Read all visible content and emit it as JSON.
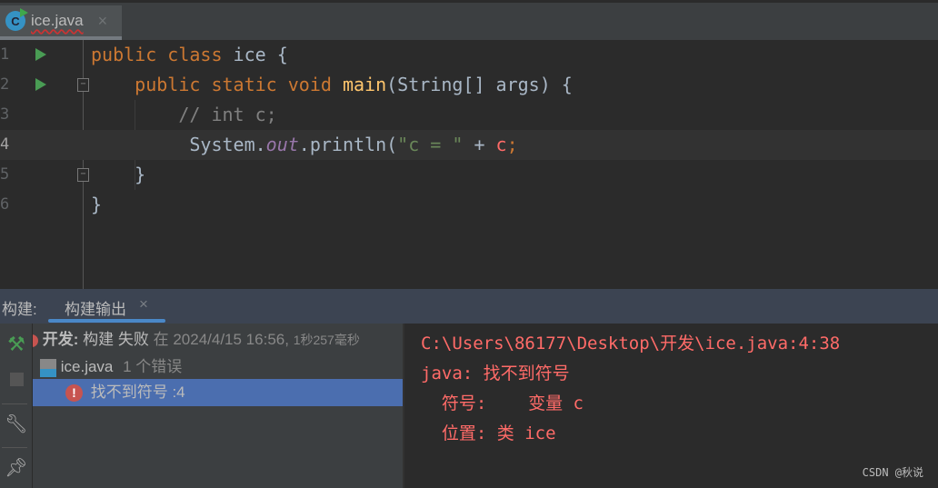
{
  "tab": {
    "filename": "ice.java",
    "close": "×",
    "icon": "java-class-icon"
  },
  "editor": {
    "lines": [
      {
        "n": "1",
        "parts": [
          [
            "kw",
            "public class "
          ],
          [
            "cls",
            "ice {"
          ]
        ]
      },
      {
        "n": "2",
        "parts": [
          [
            "kw",
            "    public static void "
          ],
          [
            "fn",
            "main"
          ],
          [
            "cls",
            "(String[] args) {"
          ]
        ]
      },
      {
        "n": "3",
        "parts": [
          [
            "cm",
            "        // int c;"
          ]
        ]
      },
      {
        "n": "4",
        "parts": [
          [
            "cls",
            "         System."
          ],
          [
            "it",
            "out"
          ],
          [
            "cls",
            ".println("
          ],
          [
            "st",
            "\"c = \""
          ],
          [
            "cls",
            " + "
          ],
          [
            "er",
            "c"
          ],
          [
            "kw",
            ";"
          ]
        ]
      },
      {
        "n": "5",
        "parts": [
          [
            "cls",
            "    }"
          ]
        ]
      },
      {
        "n": "6",
        "parts": [
          [
            "cls",
            "}"
          ]
        ]
      }
    ]
  },
  "panel": {
    "label": "构建:",
    "tab": "构建输出",
    "close": "×"
  },
  "tree": {
    "root_bold": "开发:",
    "root_status": "构建 失败",
    "root_time": "在 2024/4/15 16:56,",
    "root_dur": "1秒257毫秒",
    "file": "ice.java",
    "file_count": "1 个错误",
    "error": "找不到符号 :4"
  },
  "output": {
    "lines": [
      "C:\\Users\\86177\\Desktop\\开发\\ice.java:4:38",
      "java: 找不到符号",
      "  符号:    变量 c",
      "  位置: 类 ice"
    ]
  },
  "watermark": "CSDN @秋说"
}
